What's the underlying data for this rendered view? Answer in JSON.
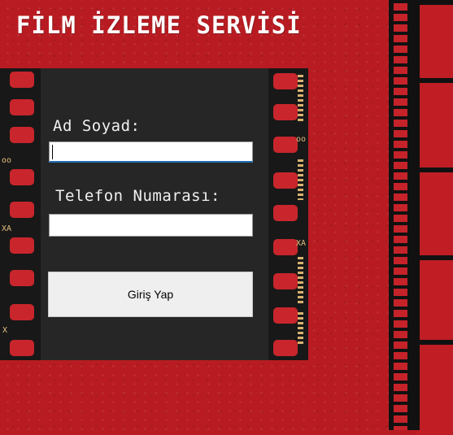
{
  "app": {
    "title": "FİLM İZLEME SERVİSİ"
  },
  "form": {
    "name_label": "Ad Soyad:",
    "name_value": "",
    "phone_label": "Telefon Numarası:",
    "phone_value": "",
    "submit_label": "Giriş Yap"
  },
  "film_codes": {
    "left_a": "oo",
    "left_b": "XA",
    "left_c": "X",
    "right_a": "oo",
    "right_b": "XA"
  },
  "colors": {
    "background": "#b81c22",
    "panel": "#262626",
    "sprocket": "#c8262c"
  }
}
